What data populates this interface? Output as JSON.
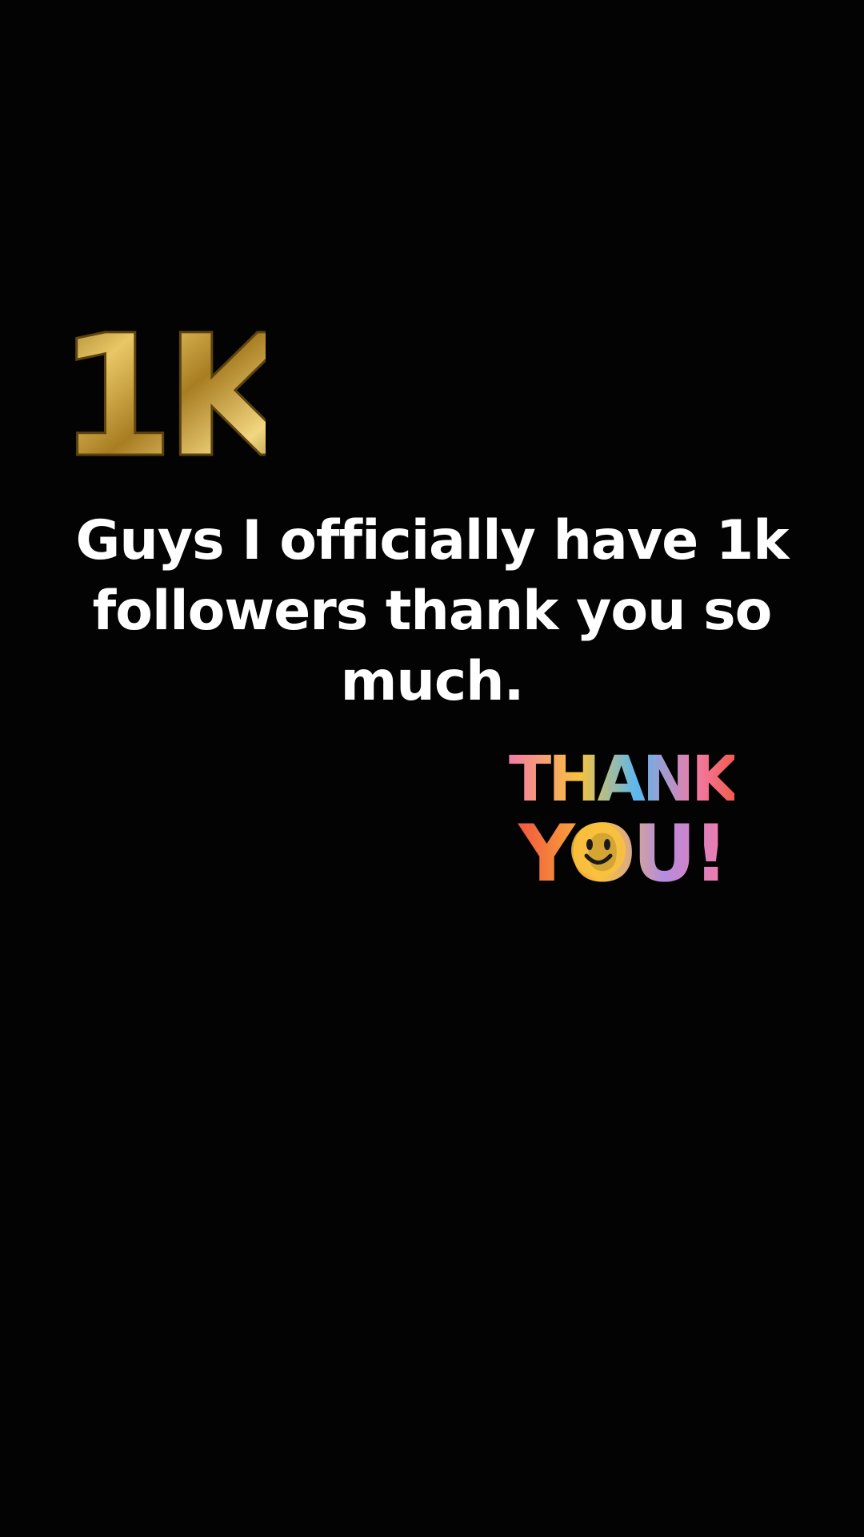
{
  "caption": {
    "text": "Guys I officially have 1k followers thank you so much."
  },
  "stickers": {
    "milestone": {
      "text": "1K",
      "icon": "gold-1k-sticker-icon",
      "color": "#C9A23A"
    },
    "thanks": {
      "line1": "THANK",
      "line2": "YOU!",
      "icon": "thank-you-smiley-sticker-icon",
      "colors": [
        "#F27BA8",
        "#F9C23C",
        "#5BB7F0",
        "#F2563C",
        "#B58CE0"
      ]
    }
  },
  "theme": {
    "background": "#030303",
    "text": "#FFFFFF"
  }
}
